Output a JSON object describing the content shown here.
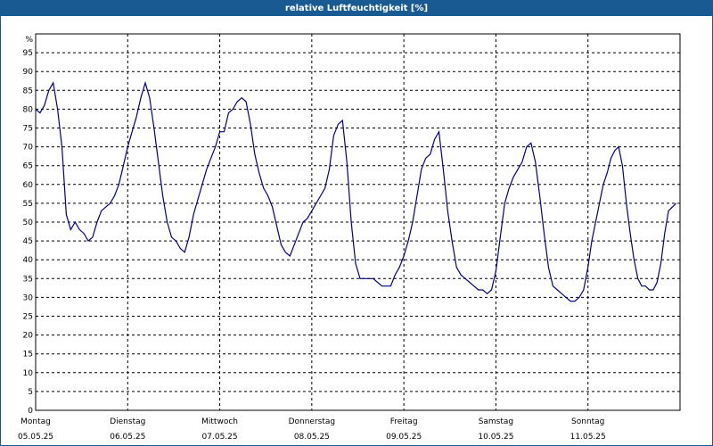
{
  "header": {
    "title": "relative Luftfeuchtigkeit [%]"
  },
  "colors": {
    "titlebar": "#1a5a92",
    "series": "#00008b",
    "grid": "#000000"
  },
  "chart_data": {
    "type": "line",
    "title": "relative Luftfeuchtigkeit [%]",
    "ylabel": "%",
    "xlabel": "",
    "ylim": [
      0,
      100
    ],
    "yticks": [
      0,
      5,
      10,
      15,
      20,
      25,
      30,
      35,
      40,
      45,
      50,
      55,
      60,
      65,
      70,
      75,
      80,
      85,
      90,
      95
    ],
    "xlim_days": [
      0,
      7
    ],
    "grid": true,
    "day_labels": [
      {
        "day": "Montag",
        "date": "05.05.25"
      },
      {
        "day": "Dienstag",
        "date": "06.05.25"
      },
      {
        "day": "Mittwoch",
        "date": "07.05.25"
      },
      {
        "day": "Donnerstag",
        "date": "08.05.25"
      },
      {
        "day": "Freitag",
        "date": "09.05.25"
      },
      {
        "day": "Samstag",
        "date": "10.05.25"
      },
      {
        "day": "Sonntag",
        "date": "11.05.25"
      }
    ],
    "series": [
      {
        "values_per_day": [
          [
            80,
            79,
            81,
            85,
            87,
            80,
            70,
            52,
            48,
            50,
            48,
            47,
            45,
            46,
            50,
            53,
            54,
            55,
            57,
            60,
            65
          ],
          [
            70,
            74,
            78,
            83,
            87,
            83,
            75,
            66,
            57,
            50,
            46,
            45,
            43,
            42,
            46,
            52,
            56,
            60,
            64,
            67,
            70
          ],
          [
            74,
            74,
            79,
            80,
            82,
            83,
            82,
            76,
            68,
            63,
            59,
            57,
            54,
            49,
            44,
            42,
            41,
            44,
            47,
            50,
            51
          ],
          [
            53,
            55,
            57,
            59,
            64,
            73,
            76,
            77,
            66,
            50,
            39,
            35,
            35,
            35,
            35,
            34,
            33,
            33,
            33,
            36,
            38
          ],
          [
            41,
            45,
            50,
            57,
            64,
            67,
            68,
            72,
            74,
            64,
            53,
            45,
            38,
            36,
            35,
            34,
            33,
            32,
            32,
            31,
            32
          ],
          [
            37,
            46,
            55,
            59,
            62,
            64,
            66,
            70,
            71,
            66,
            57,
            47,
            38,
            33,
            32,
            31,
            30,
            29,
            29,
            30,
            32
          ],
          [
            38,
            45,
            50,
            55,
            60,
            63,
            67,
            69,
            70,
            65,
            55,
            47,
            40,
            35,
            33,
            33,
            32,
            32,
            34,
            39,
            47,
            53,
            54,
            55
          ]
        ]
      }
    ]
  }
}
